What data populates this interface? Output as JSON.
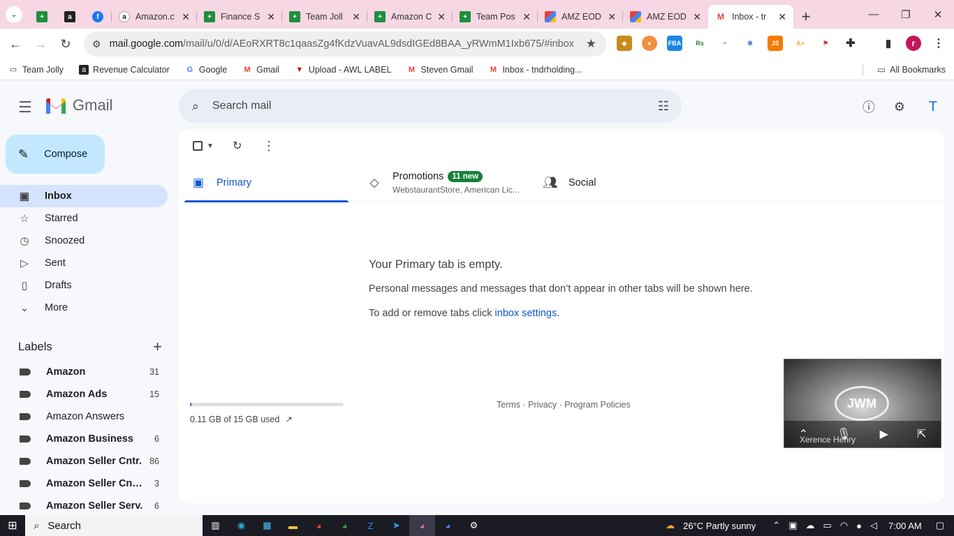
{
  "browser": {
    "tabs": [
      {
        "title": "",
        "icon": "sheets-icon"
      },
      {
        "title": "",
        "icon": "amazon-a-icon"
      },
      {
        "title": "",
        "icon": "facebook-icon"
      },
      {
        "title": "Amazon.c",
        "icon": "amazon-icon"
      },
      {
        "title": "Finance S",
        "icon": "sheets-icon"
      },
      {
        "title": "Team Joll",
        "icon": "sheets-icon"
      },
      {
        "title": "Amazon C",
        "icon": "sheets-icon"
      },
      {
        "title": "Team Pos",
        "icon": "sheets-icon"
      },
      {
        "title": "AMZ EOD",
        "icon": "clickup-icon"
      },
      {
        "title": "AMZ EOD",
        "icon": "clickup-icon"
      },
      {
        "title": "Inbox - tr",
        "icon": "gmail-icon"
      }
    ],
    "url_host": "mail.google.com",
    "url_path": "/mail/u/0/d/AEoRXRT8c1qaasZg4fKdzVuavAL9dsdIGEd8BAA_yRWmM1Ixb675/#inbox",
    "profile_initial": "r"
  },
  "bookmarks": [
    {
      "label": "Team Jolly",
      "icon": "folder-icon"
    },
    {
      "label": "Revenue Calculator",
      "icon": "amazon-icon"
    },
    {
      "label": "Google",
      "icon": "google-icon"
    },
    {
      "label": "Gmail",
      "icon": "gmail-icon"
    },
    {
      "label": "Upload - AWL LABEL",
      "icon": "awl-icon"
    },
    {
      "label": "Steven Gmail",
      "icon": "gmail-icon"
    },
    {
      "label": "Inbox - tndrholding...",
      "icon": "gmail-icon"
    }
  ],
  "bookmarks_all": "All Bookmarks",
  "gmail": {
    "logo_text": "Gmail",
    "search_placeholder": "Search mail",
    "avatar_initial": "T",
    "compose_label": "Compose",
    "nav": [
      {
        "label": "Inbox",
        "icon": "inbox-icon",
        "active": true
      },
      {
        "label": "Starred",
        "icon": "star-icon"
      },
      {
        "label": "Snoozed",
        "icon": "clock-icon"
      },
      {
        "label": "Sent",
        "icon": "send-icon"
      },
      {
        "label": "Drafts",
        "icon": "draft-icon"
      },
      {
        "label": "More",
        "icon": "chevron-down-icon"
      }
    ],
    "labels_title": "Labels",
    "labels": [
      {
        "name": "Amazon",
        "count": "31",
        "bold": true
      },
      {
        "name": "Amazon Ads",
        "count": "15",
        "bold": true
      },
      {
        "name": "Amazon Answers",
        "count": "",
        "bold": false
      },
      {
        "name": "Amazon Business",
        "count": "6",
        "bold": true
      },
      {
        "name": "Amazon Seller Cntr.",
        "count": "86",
        "bold": true
      },
      {
        "name": "Amazon Seller Cntr...",
        "count": "3",
        "bold": true
      },
      {
        "name": "Amazon Seller Serv.",
        "count": "6",
        "bold": true
      }
    ],
    "category_tabs": {
      "primary": "Primary",
      "promotions": "Promotions",
      "promotions_badge": "11 new",
      "promotions_sub": "WebstaurantStore, American Lic...",
      "social": "Social"
    },
    "empty": {
      "title": "Your Primary tab is empty.",
      "line1": "Personal messages and messages that don’t appear in other tabs will be shown here.",
      "line2_prefix": "To add or remove tabs click ",
      "line2_link": "inbox settings",
      "line2_suffix": "."
    },
    "storage_text": "0.11 GB of 15 GB used",
    "storage_fraction": 0.0073,
    "footer": "Terms · Privacy · Program Policies"
  },
  "video_call": {
    "participant": "Xerence Henry",
    "logo_text": "JWM"
  },
  "taskbar": {
    "search_label": "Search",
    "weather": "26°C  Partly sunny",
    "time": "7:00 AM"
  }
}
